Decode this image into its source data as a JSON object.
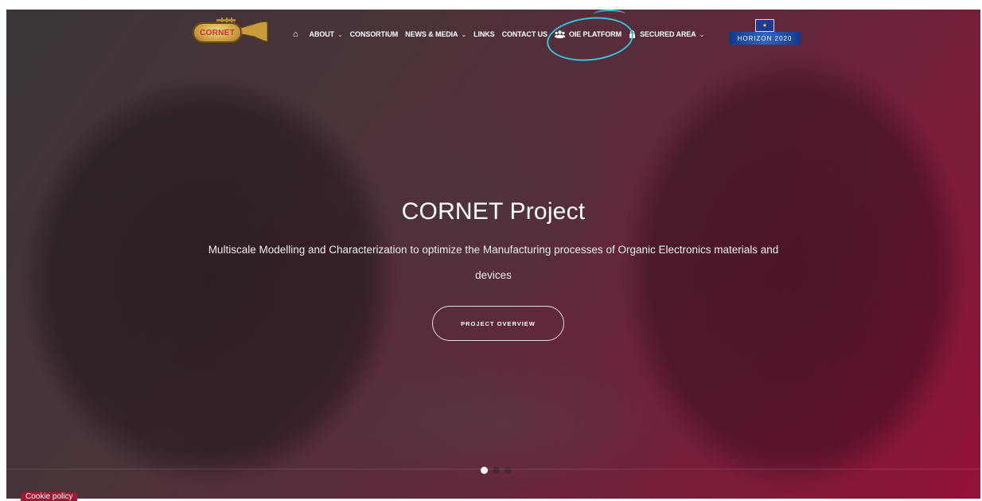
{
  "nav": {
    "logo_text": "CORNET",
    "items": [
      {
        "label": "ABOUT",
        "chevron": "⌵"
      },
      {
        "label": "CONSORTIUM"
      },
      {
        "label": "NEWS & MEDIA",
        "chevron": "⌵"
      },
      {
        "label": "LINKS"
      },
      {
        "label": "CONTACT US"
      },
      {
        "label": "OIE PLATFORM",
        "icon": "users-icon"
      },
      {
        "label": "SECURED AREA",
        "icon": "lock-icon",
        "chevron": "⌵"
      }
    ],
    "partner_logo_text": "HORIZON 2020",
    "highlight_color": "#2bc8e0"
  },
  "hero": {
    "title": "CORNET Project",
    "subtitle": "Multiscale Modelling and Characterization to optimize the Manufacturing processes of Organic Electronics materials and devices",
    "cta_label": "PROJECT OVERVIEW",
    "slides": 3,
    "active_slide": 1
  },
  "cookie": {
    "label": "Cookie policy"
  },
  "colors": {
    "accent": "#931338",
    "dark": "#3a3538",
    "cookie_bg": "#9c1a31"
  }
}
